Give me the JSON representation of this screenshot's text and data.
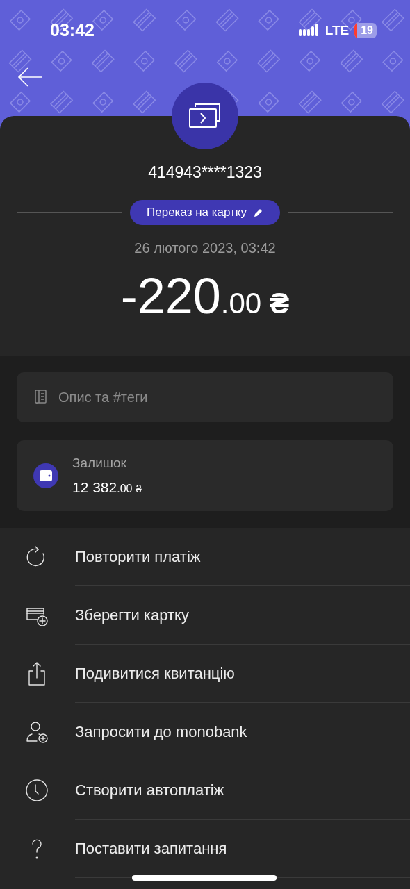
{
  "status_bar": {
    "time": "03:42",
    "network": "LTE",
    "battery": "19"
  },
  "transaction": {
    "card_number": "414943****1323",
    "category": "Переказ на картку",
    "date": "26 лютого 2023, 03:42",
    "amount": {
      "integer": "-220",
      "fraction": ".00",
      "currency": "₴"
    }
  },
  "description_field": {
    "placeholder": "Опис та #теги"
  },
  "balance": {
    "label": "Залишок",
    "integer": "12 382",
    "fraction": ".00",
    "currency": "₴"
  },
  "actions": [
    {
      "kind": "repeat",
      "label": "Повторити платіж"
    },
    {
      "kind": "card",
      "label": "Зберегти картку"
    },
    {
      "kind": "share",
      "label": "Подивитися квитанцію"
    },
    {
      "kind": "invite",
      "label": "Запросити до monobank"
    },
    {
      "kind": "clock",
      "label": "Створити автоплатіж"
    },
    {
      "kind": "question",
      "label": "Поставити запитання"
    }
  ]
}
